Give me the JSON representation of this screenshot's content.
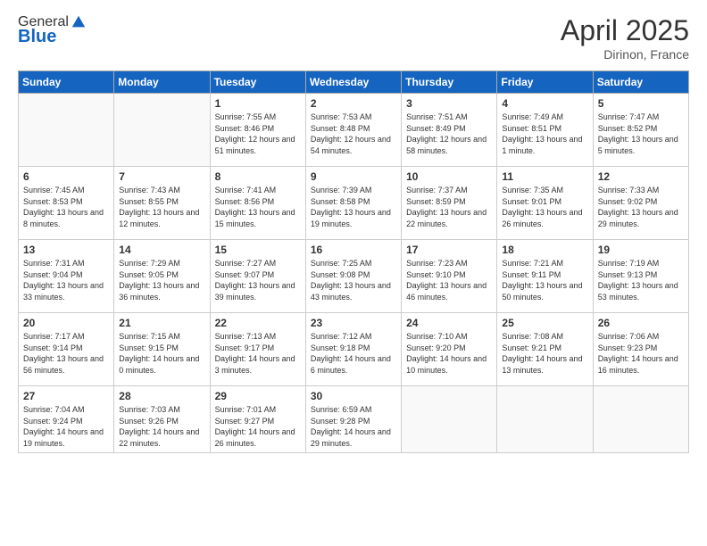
{
  "logo": {
    "general": "General",
    "blue": "Blue"
  },
  "title": {
    "month_year": "April 2025",
    "location": "Dirinon, France"
  },
  "weekdays": [
    "Sunday",
    "Monday",
    "Tuesday",
    "Wednesday",
    "Thursday",
    "Friday",
    "Saturday"
  ],
  "weeks": [
    [
      {
        "day": "",
        "info": ""
      },
      {
        "day": "",
        "info": ""
      },
      {
        "day": "1",
        "info": "Sunrise: 7:55 AM\nSunset: 8:46 PM\nDaylight: 12 hours and 51 minutes."
      },
      {
        "day": "2",
        "info": "Sunrise: 7:53 AM\nSunset: 8:48 PM\nDaylight: 12 hours and 54 minutes."
      },
      {
        "day": "3",
        "info": "Sunrise: 7:51 AM\nSunset: 8:49 PM\nDaylight: 12 hours and 58 minutes."
      },
      {
        "day": "4",
        "info": "Sunrise: 7:49 AM\nSunset: 8:51 PM\nDaylight: 13 hours and 1 minute."
      },
      {
        "day": "5",
        "info": "Sunrise: 7:47 AM\nSunset: 8:52 PM\nDaylight: 13 hours and 5 minutes."
      }
    ],
    [
      {
        "day": "6",
        "info": "Sunrise: 7:45 AM\nSunset: 8:53 PM\nDaylight: 13 hours and 8 minutes."
      },
      {
        "day": "7",
        "info": "Sunrise: 7:43 AM\nSunset: 8:55 PM\nDaylight: 13 hours and 12 minutes."
      },
      {
        "day": "8",
        "info": "Sunrise: 7:41 AM\nSunset: 8:56 PM\nDaylight: 13 hours and 15 minutes."
      },
      {
        "day": "9",
        "info": "Sunrise: 7:39 AM\nSunset: 8:58 PM\nDaylight: 13 hours and 19 minutes."
      },
      {
        "day": "10",
        "info": "Sunrise: 7:37 AM\nSunset: 8:59 PM\nDaylight: 13 hours and 22 minutes."
      },
      {
        "day": "11",
        "info": "Sunrise: 7:35 AM\nSunset: 9:01 PM\nDaylight: 13 hours and 26 minutes."
      },
      {
        "day": "12",
        "info": "Sunrise: 7:33 AM\nSunset: 9:02 PM\nDaylight: 13 hours and 29 minutes."
      }
    ],
    [
      {
        "day": "13",
        "info": "Sunrise: 7:31 AM\nSunset: 9:04 PM\nDaylight: 13 hours and 33 minutes."
      },
      {
        "day": "14",
        "info": "Sunrise: 7:29 AM\nSunset: 9:05 PM\nDaylight: 13 hours and 36 minutes."
      },
      {
        "day": "15",
        "info": "Sunrise: 7:27 AM\nSunset: 9:07 PM\nDaylight: 13 hours and 39 minutes."
      },
      {
        "day": "16",
        "info": "Sunrise: 7:25 AM\nSunset: 9:08 PM\nDaylight: 13 hours and 43 minutes."
      },
      {
        "day": "17",
        "info": "Sunrise: 7:23 AM\nSunset: 9:10 PM\nDaylight: 13 hours and 46 minutes."
      },
      {
        "day": "18",
        "info": "Sunrise: 7:21 AM\nSunset: 9:11 PM\nDaylight: 13 hours and 50 minutes."
      },
      {
        "day": "19",
        "info": "Sunrise: 7:19 AM\nSunset: 9:13 PM\nDaylight: 13 hours and 53 minutes."
      }
    ],
    [
      {
        "day": "20",
        "info": "Sunrise: 7:17 AM\nSunset: 9:14 PM\nDaylight: 13 hours and 56 minutes."
      },
      {
        "day": "21",
        "info": "Sunrise: 7:15 AM\nSunset: 9:15 PM\nDaylight: 14 hours and 0 minutes."
      },
      {
        "day": "22",
        "info": "Sunrise: 7:13 AM\nSunset: 9:17 PM\nDaylight: 14 hours and 3 minutes."
      },
      {
        "day": "23",
        "info": "Sunrise: 7:12 AM\nSunset: 9:18 PM\nDaylight: 14 hours and 6 minutes."
      },
      {
        "day": "24",
        "info": "Sunrise: 7:10 AM\nSunset: 9:20 PM\nDaylight: 14 hours and 10 minutes."
      },
      {
        "day": "25",
        "info": "Sunrise: 7:08 AM\nSunset: 9:21 PM\nDaylight: 14 hours and 13 minutes."
      },
      {
        "day": "26",
        "info": "Sunrise: 7:06 AM\nSunset: 9:23 PM\nDaylight: 14 hours and 16 minutes."
      }
    ],
    [
      {
        "day": "27",
        "info": "Sunrise: 7:04 AM\nSunset: 9:24 PM\nDaylight: 14 hours and 19 minutes."
      },
      {
        "day": "28",
        "info": "Sunrise: 7:03 AM\nSunset: 9:26 PM\nDaylight: 14 hours and 22 minutes."
      },
      {
        "day": "29",
        "info": "Sunrise: 7:01 AM\nSunset: 9:27 PM\nDaylight: 14 hours and 26 minutes."
      },
      {
        "day": "30",
        "info": "Sunrise: 6:59 AM\nSunset: 9:28 PM\nDaylight: 14 hours and 29 minutes."
      },
      {
        "day": "",
        "info": ""
      },
      {
        "day": "",
        "info": ""
      },
      {
        "day": "",
        "info": ""
      }
    ]
  ]
}
